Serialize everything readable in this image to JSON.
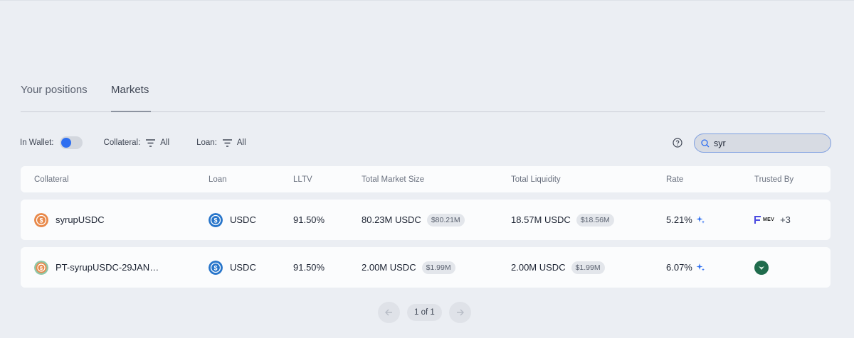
{
  "tabs": [
    {
      "label": "Your positions",
      "active": false
    },
    {
      "label": "Markets",
      "active": true
    }
  ],
  "filters": {
    "in_wallet_label": "In Wallet:",
    "in_wallet_on": true,
    "collateral_label": "Collateral:",
    "collateral_value": "All",
    "loan_label": "Loan:",
    "loan_value": "All"
  },
  "search": {
    "value": "syr",
    "icon": "search-icon"
  },
  "help_icon": "help-circle-icon",
  "table": {
    "columns": [
      "Collateral",
      "Loan",
      "LLTV",
      "Total Market Size",
      "Total Liquidity",
      "Rate",
      "Trusted By"
    ],
    "rows": [
      {
        "collateral": "syrupUSDC",
        "collateral_icon_color": "#e8894a",
        "loan": "USDC",
        "lltv": "91.50%",
        "market_size": "80.23M USDC",
        "market_size_usd": "$80.21M",
        "liquidity": "18.57M USDC",
        "liquidity_usd": "$18.56M",
        "rate": "5.21%",
        "trusted_by_label": "MEV",
        "trusted_by_extra": "+3"
      },
      {
        "collateral": "PT-syrupUSDC-29JAN…",
        "collateral_icon_color": "#e8894a",
        "loan": "USDC",
        "lltv": "91.50%",
        "market_size": "2.00M USDC",
        "market_size_usd": "$1.99M",
        "liquidity": "2.00M USDC",
        "liquidity_usd": "$1.99M",
        "rate": "6.07%",
        "trusted_by_icon_color": "#1f6b4c"
      }
    ]
  },
  "pagination": {
    "label": "1 of 1"
  },
  "colors": {
    "accent": "#2f6ff0",
    "usdc": "#2775ca",
    "background": "#ebeef3"
  }
}
